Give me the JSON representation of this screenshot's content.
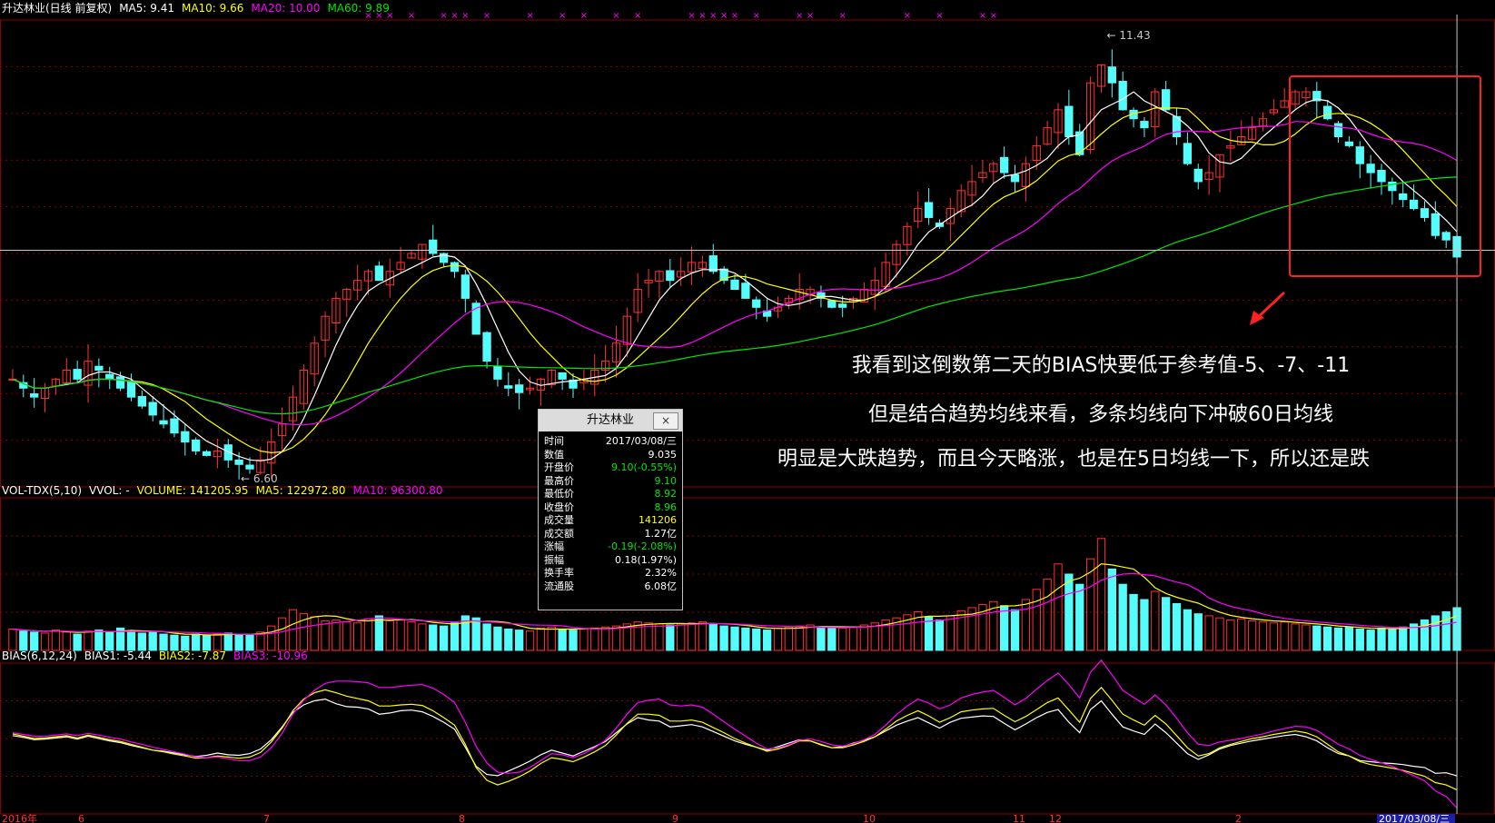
{
  "colors": {
    "up": "#ff3232",
    "down": "#54fcfc",
    "ma5": "#ffffff",
    "ma10": "#ffff00",
    "ma20": "#ff00ff",
    "ma60": "#00e600",
    "grid": "#8b0000",
    "annotation_box": "#ff2020"
  },
  "headers": {
    "price": [
      {
        "text": "升达林业(日线 前复权)",
        "color": "#ffffff"
      },
      {
        "text": "MA5: 9.41",
        "color": "#ffffff"
      },
      {
        "text": "MA10: 9.66",
        "color": "#ffff00"
      },
      {
        "text": "MA20: 10.00",
        "color": "#ff00ff"
      },
      {
        "text": "MA60: 9.89",
        "color": "#00e600"
      }
    ],
    "volume": [
      {
        "text": "VOL-TDX(5,10)",
        "color": "#ffffff"
      },
      {
        "text": "VVOL: -",
        "color": "#ffffff"
      },
      {
        "text": "VOLUME: 141205.95",
        "color": "#ffff00"
      },
      {
        "text": "MA5: 122972.80",
        "color": "#ffff00"
      },
      {
        "text": "MA10: 96300.80",
        "color": "#ff00ff"
      }
    ],
    "bias": [
      {
        "text": "BIAS(6,12,24)",
        "color": "#ffffff"
      },
      {
        "text": "BIAS1: -5.44",
        "color": "#ffffff"
      },
      {
        "text": "BIAS2: -7.87",
        "color": "#ffff00"
      },
      {
        "text": "BIAS3: -10.96",
        "color": "#ff00ff"
      }
    ]
  },
  "markers": {
    "high_label": "11.43",
    "low_label": "6.60"
  },
  "xaxis": {
    "labels": [
      "2016年",
      "6",
      "7",
      "8",
      "9",
      "10",
      "11",
      "12",
      "2",
      "2017/03/08/三"
    ]
  },
  "annotations": [
    "我看到这倒数第二天的BIAS快要低于参考值-5、-7、-11",
    "但是结合趋势均线来看，多条均线向下冲破60日均线",
    "明显是大跌趋势，而且今天略涨，也是在5日均线一下，所以还是跌"
  ],
  "info_panel": {
    "title": "升达林业",
    "close": "×",
    "rows": [
      {
        "label": "时间",
        "value": "2017/03/08/三",
        "color": "#ffffff"
      },
      {
        "label": "数值",
        "value": "9.035",
        "color": "#ffffff"
      },
      {
        "label": "开盘价",
        "value": "9.10(-0.55%)",
        "color": "#00e600"
      },
      {
        "label": "最高价",
        "value": "9.10",
        "color": "#00e600"
      },
      {
        "label": "最低价",
        "value": "8.92",
        "color": "#00e600"
      },
      {
        "label": "收盘价",
        "value": "8.96",
        "color": "#00e600"
      },
      {
        "label": "成交量",
        "value": "141206",
        "color": "#ffff00"
      },
      {
        "label": "成交额",
        "value": "1.27亿",
        "color": "#ffffff"
      },
      {
        "label": "涨幅",
        "value": "-0.19(-2.08%)",
        "color": "#00e600"
      },
      {
        "label": "振幅",
        "value": "0.18(1.97%)",
        "color": "#ffffff"
      },
      {
        "label": "换手率",
        "value": "2.32%",
        "color": "#ffffff"
      },
      {
        "label": "流通股",
        "value": "6.08亿",
        "color": "#ffffff"
      }
    ]
  },
  "chart_data": {
    "type": "candlestick",
    "price_range": [
      6.4,
      11.6
    ],
    "volume_range": [
      0,
      150000
    ],
    "bias_range": [
      -12,
      14
    ],
    "crosshair_price": 9.035,
    "close_series": [
      7.6,
      7.5,
      7.4,
      7.5,
      7.6,
      7.7,
      7.6,
      7.8,
      7.7,
      7.6,
      7.5,
      7.4,
      7.3,
      7.2,
      7.1,
      7.0,
      6.9,
      6.8,
      6.75,
      6.8,
      6.7,
      6.65,
      6.6,
      6.7,
      6.9,
      7.1,
      7.4,
      7.7,
      8.0,
      8.3,
      8.5,
      8.6,
      8.7,
      8.8,
      8.7,
      8.8,
      8.9,
      9.0,
      9.1,
      9.0,
      8.9,
      8.8,
      8.5,
      8.1,
      7.8,
      7.6,
      7.5,
      7.45,
      7.5,
      7.6,
      7.7,
      7.6,
      7.5,
      7.6,
      7.7,
      7.8,
      8.0,
      8.3,
      8.6,
      8.7,
      8.8,
      8.7,
      8.8,
      8.9,
      8.9,
      8.8,
      8.7,
      8.6,
      8.5,
      8.4,
      8.3,
      8.4,
      8.5,
      8.6,
      8.6,
      8.5,
      8.4,
      8.4,
      8.5,
      8.6,
      8.7,
      8.9,
      9.1,
      9.3,
      9.5,
      9.4,
      9.3,
      9.5,
      9.7,
      9.8,
      9.9,
      10.0,
      9.9,
      9.8,
      10.0,
      10.2,
      10.4,
      10.6,
      10.3,
      10.1,
      10.9,
      11.1,
      10.9,
      10.6,
      10.5,
      10.4,
      10.8,
      10.6,
      10.3,
      10.0,
      9.8,
      9.9,
      10.1,
      10.2,
      10.3,
      10.4,
      10.5,
      10.6,
      10.7,
      10.8,
      10.8,
      10.7,
      10.5,
      10.3,
      10.2,
      10.0,
      9.9,
      9.8,
      9.7,
      9.6,
      9.5,
      9.4,
      9.2,
      9.15,
      8.96
    ],
    "volume_series": [
      2.1,
      1.9,
      1.8,
      1.7,
      2.0,
      1.8,
      1.6,
      1.9,
      2.0,
      1.8,
      2.2,
      1.9,
      1.7,
      1.8,
      1.6,
      1.5,
      1.4,
      1.6,
      1.5,
      1.6,
      1.7,
      1.6,
      1.5,
      1.8,
      2.4,
      3.2,
      4.0,
      3.6,
      3.3,
      2.9,
      3.0,
      2.8,
      2.7,
      3.1,
      3.4,
      2.9,
      3.0,
      2.8,
      2.6,
      2.5,
      2.4,
      2.7,
      3.4,
      3.2,
      2.6,
      2.3,
      2.1,
      2.0,
      1.9,
      2.2,
      2.3,
      2.1,
      2.0,
      2.1,
      2.2,
      2.3,
      2.4,
      2.6,
      2.8,
      2.7,
      2.6,
      2.5,
      2.6,
      2.7,
      2.8,
      2.6,
      2.4,
      2.3,
      2.2,
      2.1,
      2.0,
      2.2,
      2.3,
      2.4,
      2.5,
      2.3,
      2.2,
      2.2,
      2.3,
      2.5,
      2.7,
      3.0,
      3.2,
      3.5,
      3.8,
      3.3,
      3.0,
      3.4,
      3.9,
      4.2,
      4.5,
      4.8,
      4.4,
      4.0,
      5.0,
      6.0,
      7.0,
      8.5,
      7.5,
      6.5,
      9.0,
      11.0,
      8.0,
      6.5,
      5.5,
      5.0,
      5.8,
      5.2,
      4.6,
      4.0,
      3.6,
      3.4,
      3.2,
      3.0,
      3.1,
      2.9,
      2.8,
      2.7,
      2.8,
      2.6,
      2.5,
      2.4,
      2.3,
      2.2,
      2.3,
      2.1,
      2.0,
      2.2,
      2.1,
      2.3,
      2.6,
      3.0,
      3.4,
      3.8,
      4.2
    ],
    "bias1_series": [
      1.5,
      1.2,
      0.8,
      0.9,
      1.1,
      1.3,
      0.9,
      1.4,
      1.0,
      0.6,
      0.3,
      -0.2,
      -0.6,
      -1.0,
      -1.2,
      -1.5,
      -1.8,
      -2.1,
      -1.9,
      -1.5,
      -1.8,
      -1.9,
      -1.6,
      -0.8,
      0.8,
      3.0,
      5.5,
      6.8,
      7.5,
      7.8,
      7.0,
      6.5,
      6.4,
      6.1,
      5.2,
      5.4,
      5.8,
      5.9,
      5.6,
      4.8,
      3.8,
      2.6,
      -0.5,
      -3.8,
      -5.2,
      -5.4,
      -4.6,
      -3.8,
      -2.9,
      -1.8,
      -1.0,
      -1.5,
      -2.0,
      -1.2,
      -0.4,
      0.5,
      2.0,
      3.5,
      4.6,
      4.2,
      4.0,
      3.0,
      3.2,
      3.4,
      3.0,
      2.2,
      1.4,
      0.6,
      0.0,
      -0.5,
      -1.0,
      -0.4,
      0.2,
      0.8,
      0.6,
      -0.1,
      -0.6,
      -0.4,
      0.2,
      0.7,
      1.3,
      2.3,
      3.3,
      4.0,
      4.6,
      3.7,
      2.8,
      3.8,
      4.5,
      4.7,
      4.9,
      4.8,
      3.6,
      2.5,
      3.5,
      4.6,
      5.5,
      6.0,
      3.8,
      2.0,
      6.0,
      7.5,
      5.2,
      3.0,
      2.3,
      1.7,
      3.5,
      2.0,
      0.2,
      -1.6,
      -2.6,
      -1.8,
      -0.8,
      -0.2,
      0.2,
      0.6,
      0.9,
      1.2,
      1.5,
      1.7,
      1.3,
      0.6,
      -0.6,
      -1.6,
      -2.0,
      -2.8,
      -3.0,
      -3.2,
      -3.3,
      -3.5,
      -3.8,
      -4.0,
      -5.0,
      -4.9,
      -5.44
    ],
    "bias2_series": [
      1.8,
      1.4,
      1.0,
      1.1,
      1.3,
      1.5,
      1.1,
      1.6,
      1.2,
      0.8,
      0.5,
      0.0,
      -0.5,
      -1.0,
      -1.3,
      -1.7,
      -2.0,
      -2.4,
      -2.3,
      -2.0,
      -2.2,
      -2.4,
      -2.2,
      -1.4,
      0.4,
      2.8,
      5.8,
      7.8,
      8.9,
      9.4,
      8.9,
      8.3,
      7.9,
      7.5,
      6.6,
      6.6,
      6.8,
      6.9,
      6.7,
      5.8,
      4.6,
      3.3,
      0.0,
      -4.0,
      -6.2,
      -7.0,
      -6.4,
      -5.6,
      -4.6,
      -3.3,
      -2.3,
      -2.6,
      -3.0,
      -2.2,
      -1.3,
      -0.2,
      1.6,
      3.6,
      5.2,
      5.2,
      5.0,
      4.0,
      4.0,
      4.2,
      3.8,
      2.9,
      2.0,
      1.0,
      0.2,
      -0.5,
      -1.2,
      -0.8,
      -0.2,
      0.6,
      0.6,
      0.0,
      -0.6,
      -0.6,
      -0.1,
      0.5,
      1.3,
      2.6,
      4.0,
      5.0,
      5.8,
      4.9,
      3.8,
      4.6,
      5.6,
      5.9,
      6.1,
      6.2,
      5.0,
      3.9,
      4.8,
      6.0,
      7.2,
      8.0,
      5.9,
      3.8,
      7.9,
      9.8,
      7.6,
      5.2,
      4.2,
      3.3,
      5.0,
      3.5,
      1.5,
      -0.6,
      -2.0,
      -1.6,
      -0.6,
      0.0,
      0.5,
      1.0,
      1.3,
      1.7,
      2.0,
      2.3,
      2.0,
      1.3,
      0.0,
      -1.3,
      -2.0,
      -3.0,
      -3.5,
      -3.8,
      -4.1,
      -4.5,
      -5.0,
      -5.5,
      -6.6,
      -7.0,
      -7.87
    ],
    "bias3_series": [
      2.0,
      1.7,
      1.4,
      1.4,
      1.6,
      1.8,
      1.5,
      1.9,
      1.6,
      1.2,
      0.9,
      0.4,
      0.0,
      -0.5,
      -0.9,
      -1.3,
      -1.7,
      -2.2,
      -2.3,
      -2.2,
      -2.5,
      -2.8,
      -2.8,
      -2.2,
      -0.6,
      1.9,
      5.2,
      7.6,
      9.3,
      10.5,
      10.9,
      10.9,
      10.8,
      10.6,
      9.8,
      9.8,
      10.0,
      10.2,
      10.3,
      9.7,
      8.6,
      7.2,
      3.8,
      -0.4,
      -3.2,
      -4.8,
      -5.0,
      -4.8,
      -4.0,
      -2.8,
      -1.6,
      -1.8,
      -2.3,
      -1.6,
      -0.6,
      0.7,
      2.8,
      5.2,
      7.2,
      7.6,
      7.8,
      6.8,
      6.6,
      6.8,
      6.4,
      5.2,
      3.9,
      2.6,
      1.4,
      0.2,
      -0.8,
      -0.6,
      -0.1,
      0.7,
      0.9,
      0.5,
      -0.1,
      -0.3,
      0.1,
      0.8,
      1.7,
      3.3,
      5.1,
      6.6,
      7.8,
      7.1,
      6.1,
      6.8,
      8.0,
      8.6,
      9.0,
      9.3,
      8.1,
      6.8,
      7.9,
      9.5,
      11.0,
      12.3,
      10.3,
      8.0,
      12.4,
      14.5,
      12.0,
      9.3,
      8.1,
      6.9,
      8.5,
      6.8,
      4.5,
      2.0,
      0.0,
      -0.2,
      0.4,
      0.7,
      1.0,
      1.4,
      1.8,
      2.3,
      2.7,
      3.1,
      3.0,
      2.4,
      1.2,
      0.0,
      -0.8,
      -1.9,
      -2.6,
      -3.2,
      -3.8,
      -4.6,
      -5.4,
      -6.3,
      -8.0,
      -9.0,
      -10.96
    ]
  }
}
